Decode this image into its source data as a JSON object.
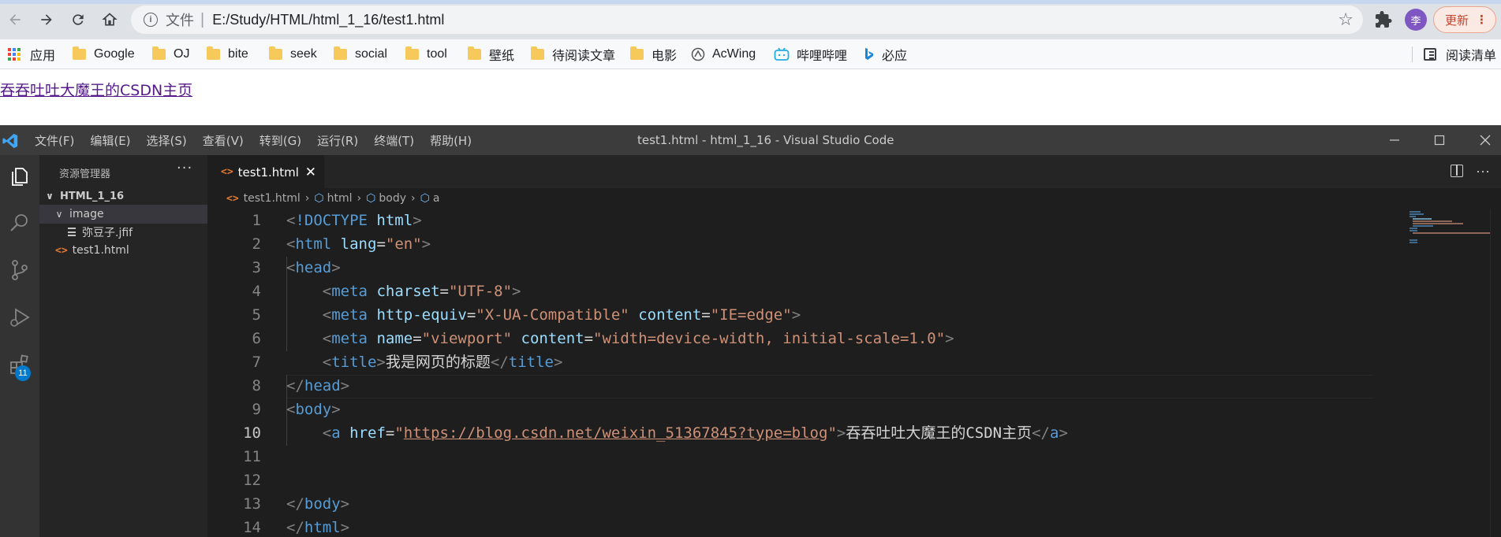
{
  "browser": {
    "address_label": "文件",
    "url": "E:/Study/HTML/html_1_16/test1.html",
    "avatar_text": "李",
    "update_label": "更新",
    "bookmarks": [
      "应用",
      "Google",
      "OJ",
      "bite",
      "seek",
      "social",
      "tool",
      "壁纸",
      "待阅读文章",
      "电影",
      "AcWing",
      "哔哩哔哩",
      "必应"
    ],
    "reading_list": "阅读清单",
    "page_link_text": "吞吞吐吐大魔王的CSDN主页"
  },
  "vscode": {
    "menu": [
      "文件(F)",
      "编辑(E)",
      "选择(S)",
      "查看(V)",
      "转到(G)",
      "运行(R)",
      "终端(T)",
      "帮助(H)"
    ],
    "window_title": "test1.html - html_1_16 - Visual Studio Code",
    "extensions_badge": "11",
    "explorer": {
      "title": "资源管理器",
      "more": "···",
      "root": "HTML_1_16",
      "folder": "image",
      "folder_file": "弥豆子.jfif",
      "file": "test1.html"
    },
    "tab_label": "test1.html",
    "breadcrumb": [
      "test1.html",
      "html",
      "body",
      "a"
    ],
    "line_numbers": [
      "1",
      "2",
      "3",
      "4",
      "5",
      "6",
      "7",
      "8",
      "9",
      "10",
      "11",
      "12",
      "13",
      "14"
    ],
    "code": {
      "l1_tag": "!DOCTYPE",
      "l1_word": "html",
      "l2_tag": "html",
      "l2_attr": "lang",
      "l2_val": "\"en\"",
      "l3_tag": "head",
      "l4_tag": "meta",
      "l4_attr": "charset",
      "l4_val": "\"UTF-8\"",
      "l5_tag": "meta",
      "l5_attr1": "http-equiv",
      "l5_val1": "\"X-UA-Compatible\"",
      "l5_attr2": "content",
      "l5_val2": "\"IE=edge\"",
      "l6_tag": "meta",
      "l6_attr1": "name",
      "l6_val1": "\"viewport\"",
      "l6_attr2": "content",
      "l6_val2": "\"width=device-width, initial-scale=1.0\"",
      "l7_tag": "title",
      "l7_text": "我是网页的标题",
      "l8_tag": "head",
      "l9_tag": "body",
      "l10_tag": "a",
      "l10_attr": "href",
      "l10_quote": "\"",
      "l10_url": "https://blog.csdn.net/weixin_51367845?type=blog",
      "l10_text": "吞吞吐吐大魔王的CSDN主页",
      "l13_tag": "body",
      "l14_tag": "html"
    }
  }
}
